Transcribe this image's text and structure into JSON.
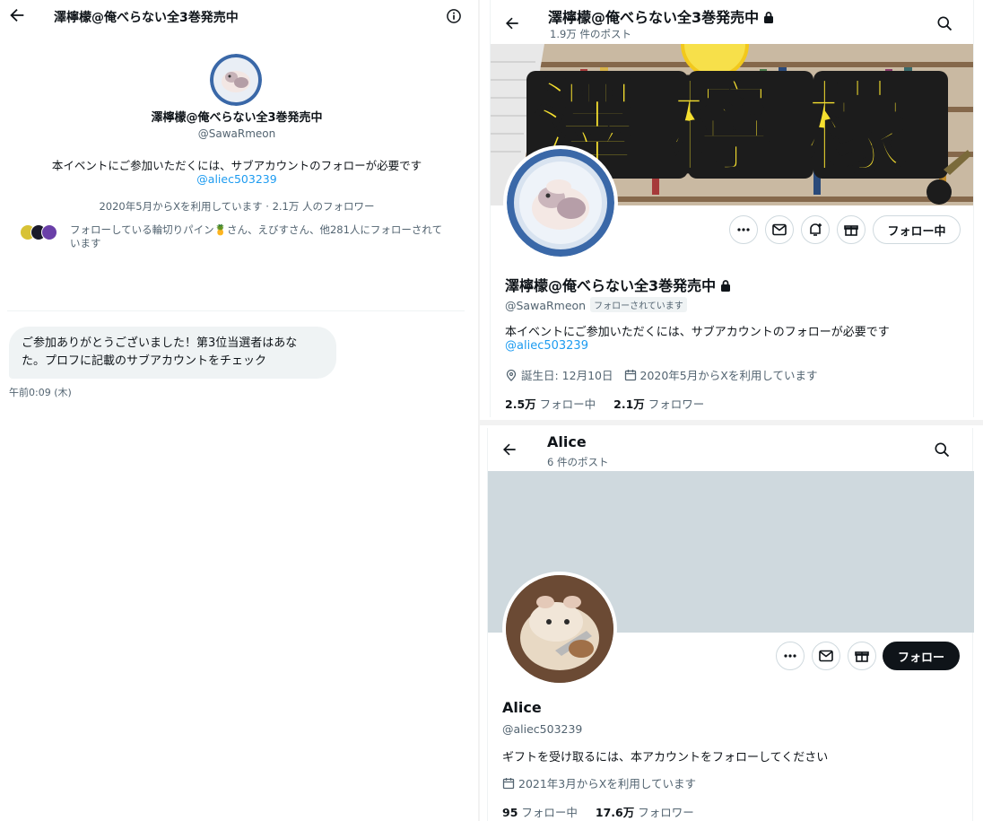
{
  "dm": {
    "title": "澤檸檬@俺べらない全3巻発売中",
    "name": "澤檸檬@俺べらない全3巻発売中",
    "handle": "@SawaRmeon",
    "bio": "本イベントにご参加いただくには、サブアカウントのフォローが必要です",
    "bio_link": "@aliec503239",
    "meta": "2020年5月からXを利用しています · 2.1万 人のフォロワー",
    "followed_by_line1": "フォローしている輪切りパイン🍍さん、えびすさん、他281人にフォローされて",
    "followed_by_line2": "います",
    "message_line1": "ご参加ありがとうございました！第3位当選者はあな",
    "message_line2": "た。プロフに記載のサブアカウントをチェック",
    "timestamp": "午前0:09 (木)"
  },
  "profile1": {
    "title": "澤檸檬@俺べらない全3巻発売中",
    "post_count": "1.9万 件のポスト",
    "banner_text": "澤檸檬",
    "name": "澤檸檬@俺べらない全3巻発売中",
    "handle": "@SawaRmeon",
    "follows_you": "フォローされています",
    "bio": "本イベントにご参加いただくには、サブアカウントのフォローが必要です",
    "bio_link": "@aliec503239",
    "birthday": "誕生日: 12月10日",
    "joined": "2020年5月からXを利用しています",
    "following_count": "2.5万",
    "following_label": "フォロー中",
    "followers_count": "2.1万",
    "followers_label": "フォロワー",
    "follow_button": "フォロー中"
  },
  "profile2": {
    "title": "Alice",
    "post_count": "6 件のポスト",
    "name": "Alice",
    "handle": "@aliec503239",
    "bio": "ギフトを受け取るには、本アカウントをフォローしてください",
    "joined": "2021年3月からXを利用しています",
    "following_count": "95",
    "following_label": "フォロー中",
    "followers_count": "17.6万",
    "followers_label": "フォロワー",
    "follow_button": "フォロー"
  },
  "colors": {
    "accent": "#1d9bf0",
    "text": "#0f1419",
    "secondary": "#536471",
    "banner_yellow": "#f5df2f",
    "banner2_gray": "#cfd9de"
  }
}
